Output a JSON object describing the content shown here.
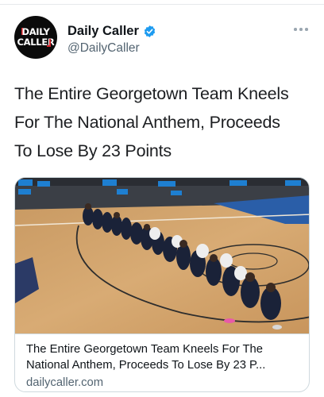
{
  "tweet": {
    "display_name": "Daily Caller",
    "handle": "@DailyCaller",
    "avatar_logo": [
      "DAILY",
      "CALLER"
    ],
    "text_lines": [
      "The Entire Georgetown Team Kneels",
      "For The National Anthem, Proceeds",
      "To Lose By 23 Points"
    ],
    "verified_color": "#1d9bf0",
    "more_icon": "more-horizontal-icon"
  },
  "card": {
    "image_subject": "basketball-team-kneeling-photo",
    "title_lines": [
      "The Entire Georgetown Team Kneels For The",
      "National Anthem, Proceeds To Lose By 23 P..."
    ],
    "domain": "dailycaller.com"
  }
}
